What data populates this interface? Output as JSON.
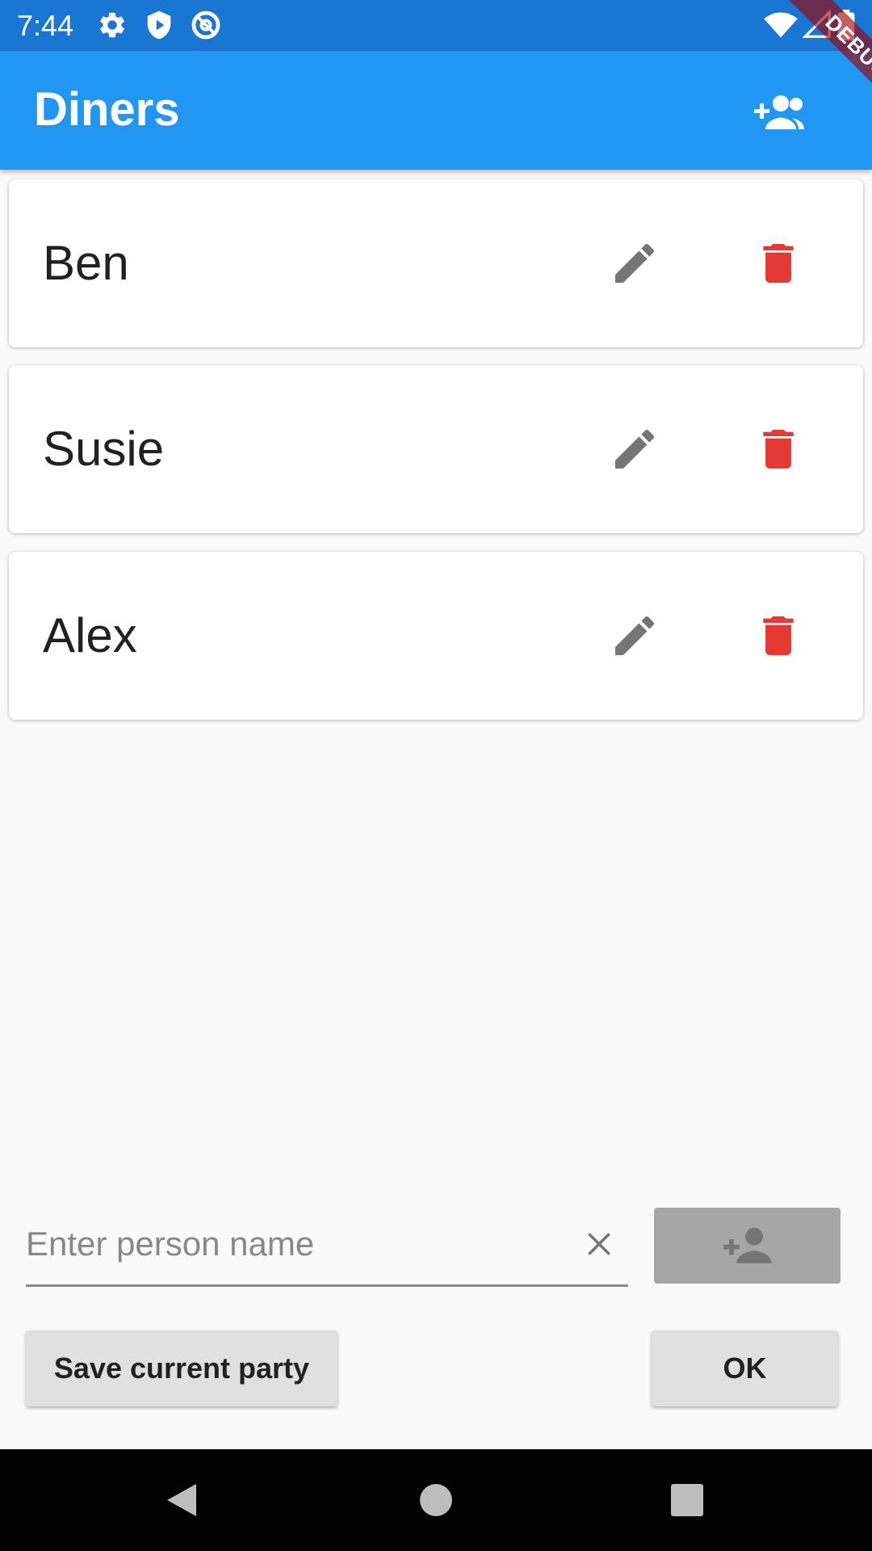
{
  "status_bar": {
    "time": "7:44",
    "left_icons": [
      "gear-icon",
      "shield-play-icon",
      "at-sign-icon"
    ],
    "right_icons": [
      "wifi-icon",
      "signal-icon",
      "battery-icon"
    ]
  },
  "app_bar": {
    "title": "Diners",
    "action_icon": "group-add-icon",
    "color": "#2196f3",
    "debug_label": "DEBUG"
  },
  "diners": [
    {
      "name": "Ben"
    },
    {
      "name": "Susie"
    },
    {
      "name": "Alex"
    }
  ],
  "icons": {
    "edit": "pencil-icon",
    "delete": "trash-icon",
    "edit_color": "#757575",
    "delete_color": "#e53935"
  },
  "input": {
    "placeholder": "Enter person name",
    "value": ""
  },
  "buttons": {
    "save_label": "Save current party",
    "ok_label": "OK"
  },
  "nav": [
    "back-icon",
    "home-icon",
    "recents-icon"
  ]
}
